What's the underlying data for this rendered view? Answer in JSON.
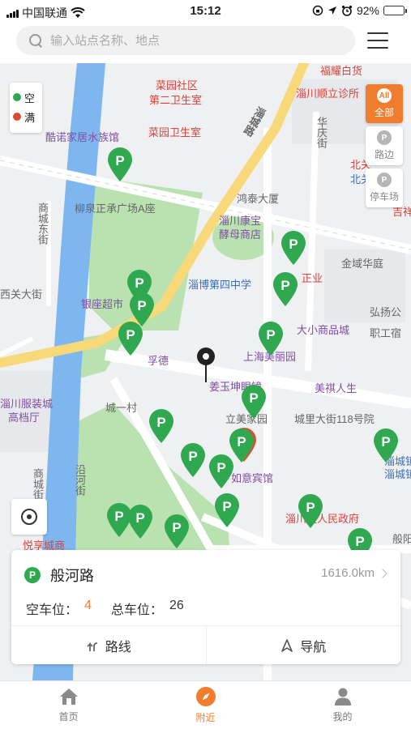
{
  "status_bar": {
    "carrier": "中国联通",
    "time": "15:12",
    "battery": "92%",
    "battery_level": 0.92
  },
  "search": {
    "placeholder": "输入站点名称、地点",
    "value": ""
  },
  "menu_icon": "hamburger-menu-icon",
  "legend": {
    "items": [
      {
        "label": "空",
        "color": "#2fa84f"
      },
      {
        "label": "满",
        "color": "#e14b2d"
      }
    ]
  },
  "filters": [
    {
      "label": "全部",
      "badge": "All",
      "active": true
    },
    {
      "label": "路边",
      "badge": "P",
      "active": false
    },
    {
      "label": "停车场",
      "badge": "P",
      "active": false
    }
  ],
  "map": {
    "accent_green": "#2fa84f",
    "accent_red": "#e14b2d",
    "labels": [
      {
        "text": "福耀白货",
        "color": "red"
      },
      {
        "text": "菜园社区",
        "color": "red"
      },
      {
        "text": "第二卫生室",
        "color": "red"
      },
      {
        "text": "淄川顺立诊所",
        "color": "red"
      },
      {
        "text": "菜园卫生室",
        "color": "red"
      },
      {
        "text": "酷诺家居水族馆",
        "color": "purple"
      },
      {
        "text": "柳泉正承广场A座",
        "color": "gray"
      },
      {
        "text": "鸿泰大厦",
        "color": "gray"
      },
      {
        "text": "淄川康宝",
        "color": "purple"
      },
      {
        "text": "酵母商店",
        "color": "purple"
      },
      {
        "text": "淄博第四中学",
        "color": "blue"
      },
      {
        "text": "金域华庭",
        "color": "gray"
      },
      {
        "text": "银座超市",
        "color": "purple"
      },
      {
        "text": "孚德",
        "color": "purple"
      },
      {
        "text": "上海美丽园",
        "color": "purple"
      },
      {
        "text": "大小商品城",
        "color": "purple"
      },
      {
        "text": "弘扬公",
        "color": "gray"
      },
      {
        "text": "职工宿",
        "color": "gray"
      },
      {
        "text": "姜玉坤眼镜",
        "color": "purple"
      },
      {
        "text": "美祺人生",
        "color": "purple"
      },
      {
        "text": "淄川服装城",
        "color": "purple"
      },
      {
        "text": "高档厅",
        "color": "purple"
      },
      {
        "text": "立美家园",
        "color": "gray"
      },
      {
        "text": "城里大街118号院",
        "color": "gray"
      },
      {
        "text": "淄城镇",
        "color": "blue"
      },
      {
        "text": "淄城镇",
        "color": "blue"
      },
      {
        "text": "淄川区人民政府",
        "color": "red"
      },
      {
        "text": "般阳",
        "color": "gray"
      },
      {
        "text": "如意宾馆",
        "color": "purple"
      },
      {
        "text": "淄城路",
        "color": "gray"
      },
      {
        "text": "华庆街",
        "color": "gray"
      },
      {
        "text": "北关",
        "color": "blue"
      },
      {
        "text": "吉祥",
        "color": "red"
      },
      {
        "text": "商城东街",
        "color": "gray"
      },
      {
        "text": "西关大街",
        "color": "gray"
      },
      {
        "text": "城一村",
        "color": "gray"
      },
      {
        "text": "沿河街",
        "color": "gray"
      },
      {
        "text": "商城街",
        "color": "gray"
      },
      {
        "text": "悦享城商",
        "color": "red"
      },
      {
        "text": "正业",
        "color": "red"
      },
      {
        "text": "北关",
        "color": "red"
      }
    ],
    "pins": [
      {
        "status": "free",
        "icon": "parking-pin-icon"
      },
      {
        "status": "free",
        "icon": "parking-pin-icon"
      },
      {
        "status": "free",
        "icon": "parking-pin-icon"
      },
      {
        "status": "free",
        "icon": "parking-pin-icon"
      },
      {
        "status": "free",
        "icon": "parking-pin-icon"
      },
      {
        "status": "free",
        "icon": "parking-pin-icon"
      },
      {
        "status": "free",
        "icon": "parking-pin-icon"
      },
      {
        "status": "free",
        "icon": "parking-pin-icon"
      },
      {
        "status": "free",
        "icon": "parking-pin-icon"
      },
      {
        "status": "free",
        "icon": "parking-pin-icon"
      },
      {
        "status": "full",
        "icon": "parking-pin-icon"
      },
      {
        "status": "free",
        "icon": "parking-pin-icon"
      },
      {
        "status": "free",
        "icon": "parking-pin-icon"
      },
      {
        "status": "free",
        "icon": "parking-pin-icon"
      },
      {
        "status": "free",
        "icon": "parking-pin-icon"
      },
      {
        "status": "free",
        "icon": "parking-pin-icon"
      },
      {
        "status": "free",
        "icon": "parking-pin-icon"
      },
      {
        "status": "free",
        "icon": "parking-pin-icon"
      },
      {
        "status": "free",
        "icon": "parking-pin-icon"
      },
      {
        "status": "free",
        "icon": "parking-pin-icon"
      }
    ]
  },
  "station": {
    "name": "般河路",
    "distance": "1616.0km",
    "free_label": "空车位：",
    "free_count": "4",
    "total_label": "总车位：",
    "total_count": "26",
    "route_label": "路线",
    "navigate_label": "导航"
  },
  "tabbar": [
    {
      "label": "首页",
      "icon": "home-icon",
      "active": false
    },
    {
      "label": "附近",
      "icon": "compass-icon",
      "active": true
    },
    {
      "label": "我的",
      "icon": "user-icon",
      "active": false
    }
  ]
}
